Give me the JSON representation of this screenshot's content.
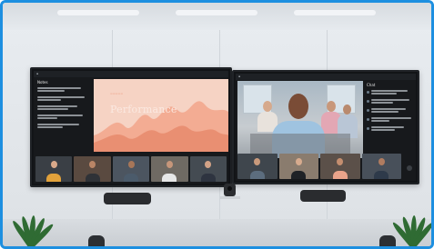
{
  "scene": {
    "accent_border": "#1d8fe0"
  },
  "left_display": {
    "notes_title": "Notes",
    "slide": {
      "title": "Performance",
      "background": "#f6d3c4",
      "chart_colors": [
        "#f2a58b",
        "#e98f72"
      ]
    },
    "participants": [
      {
        "top": "#3a3f45",
        "skin": "#d9a98a",
        "shirt": "#e2a23b"
      },
      {
        "top": "#5a4a40",
        "skin": "#b98566",
        "shirt": "#2f3237"
      },
      {
        "top": "#4c5560",
        "skin": "#a77658",
        "shirt": "#4b5b6b"
      },
      {
        "top": "#6f6a63",
        "skin": "#c6967a",
        "shirt": "#e7e7e7"
      },
      {
        "top": "#444b52",
        "skin": "#d2a286",
        "shirt": "#2e3440"
      }
    ]
  },
  "right_display": {
    "chat_title": "Chat",
    "participants": [
      {
        "top": "#3f464d",
        "skin": "#c99a7c",
        "shirt": "#5c6d7e"
      },
      {
        "top": "#8a7c6e",
        "skin": "#d7ab8e",
        "shirt": "#1f2226"
      },
      {
        "top": "#5b5049",
        "skin": "#c48e6f",
        "shirt": "#e9a38a"
      },
      {
        "top": "#48505a",
        "skin": "#b07c60",
        "shirt": "#2e3a4a"
      }
    ]
  }
}
